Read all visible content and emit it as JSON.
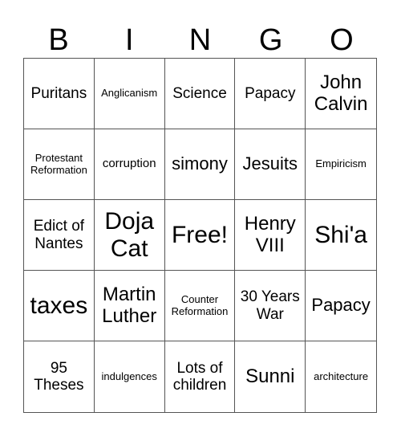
{
  "header": [
    "B",
    "I",
    "N",
    "G",
    "O"
  ],
  "cells": [
    {
      "text": "Puritans",
      "size": "md"
    },
    {
      "text": "Anglicanism",
      "size": "xs"
    },
    {
      "text": "Science",
      "size": "md"
    },
    {
      "text": "Papacy",
      "size": "md"
    },
    {
      "text": "John Calvin",
      "size": "xl"
    },
    {
      "text": "Protestant Reformation",
      "size": "xs"
    },
    {
      "text": "corruption",
      "size": "sm"
    },
    {
      "text": "simony",
      "size": "lg"
    },
    {
      "text": "Jesuits",
      "size": "lg"
    },
    {
      "text": "Empiricism",
      "size": "xs"
    },
    {
      "text": "Edict of Nantes",
      "size": "md"
    },
    {
      "text": "Doja Cat",
      "size": "xxl"
    },
    {
      "text": "Free!",
      "size": "xxl"
    },
    {
      "text": "Henry VIII",
      "size": "xl"
    },
    {
      "text": "Shi'a",
      "size": "xxl"
    },
    {
      "text": "taxes",
      "size": "xxl"
    },
    {
      "text": "Martin Luther",
      "size": "xl"
    },
    {
      "text": "Counter Reformation",
      "size": "xs"
    },
    {
      "text": "30 Years War",
      "size": "md"
    },
    {
      "text": "Papacy",
      "size": "lg"
    },
    {
      "text": "95 Theses",
      "size": "md"
    },
    {
      "text": "indulgences",
      "size": "xs"
    },
    {
      "text": "Lots of children",
      "size": "md"
    },
    {
      "text": "Sunni",
      "size": "xl"
    },
    {
      "text": "architecture",
      "size": "xs"
    }
  ]
}
